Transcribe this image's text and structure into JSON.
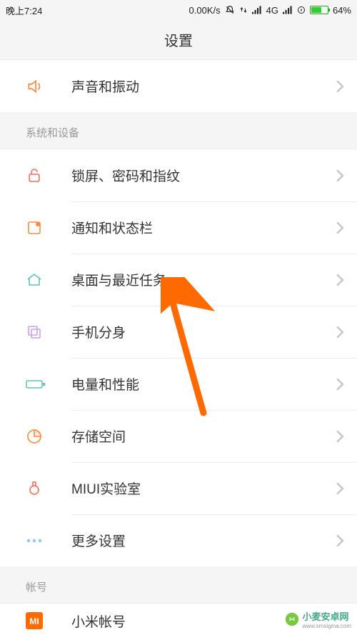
{
  "status": {
    "time": "晚上7:24",
    "net_speed": "0.00K/s",
    "net_type": "4G",
    "battery_pct": "64%"
  },
  "header": {
    "title": "设置"
  },
  "top_row": {
    "label": "声音和振动"
  },
  "section1": {
    "title": "系统和设备",
    "items": [
      {
        "label": "锁屏、密码和指纹",
        "icon": "lock"
      },
      {
        "label": "通知和状态栏",
        "icon": "notification"
      },
      {
        "label": "桌面与最近任务",
        "icon": "home"
      },
      {
        "label": "手机分身",
        "icon": "clone"
      },
      {
        "label": "电量和性能",
        "icon": "battery"
      },
      {
        "label": "存储空间",
        "icon": "storage"
      },
      {
        "label": "MIUI实验室",
        "icon": "lab"
      },
      {
        "label": "更多设置",
        "icon": "more"
      }
    ]
  },
  "section2": {
    "title": "帐号",
    "items": [
      {
        "label": "小米帐号",
        "icon": "mi"
      }
    ]
  },
  "watermark": {
    "text": "小麦安卓网",
    "url": "www.xmsigma.com"
  },
  "colors": {
    "accent": "#ff6a00",
    "icon_stroke": "#ff6a00",
    "icon_alt": "#bfbfbf"
  }
}
